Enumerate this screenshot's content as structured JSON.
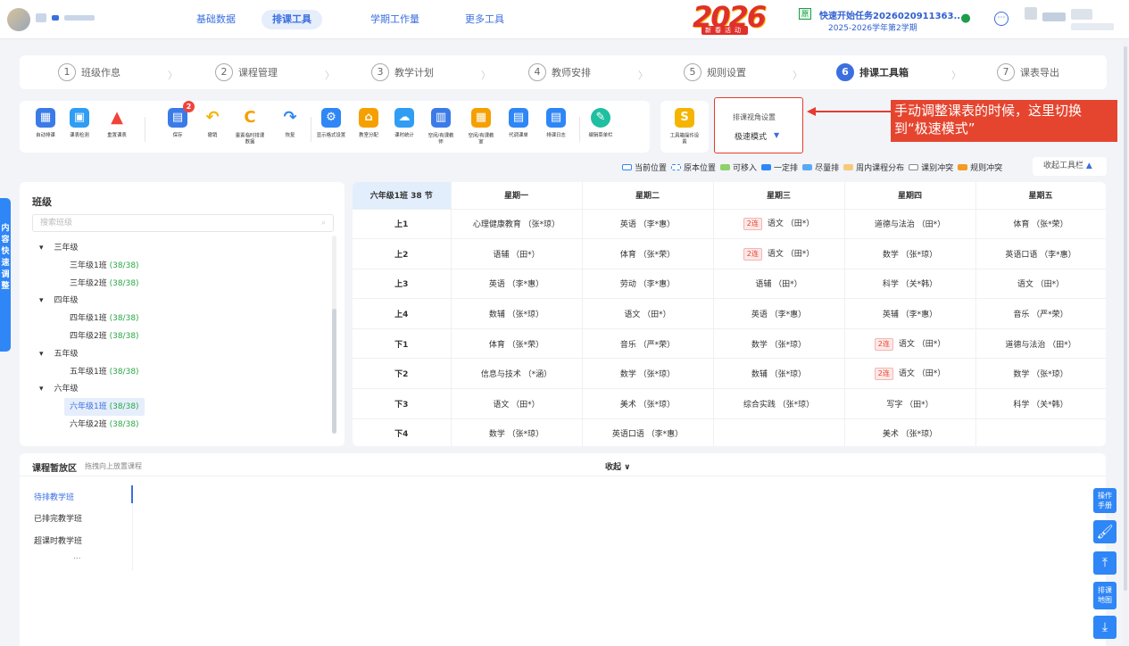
{
  "nav": {
    "links": [
      "基础数据",
      "排课工具",
      "学期工作量",
      "更多工具"
    ],
    "active": 1,
    "event_year": "2026",
    "event_sub": "新春活动",
    "task_tag": "原",
    "task_title": "快速开始任务2026020911363...",
    "term": "2025-2026学年第2学期"
  },
  "steps": [
    {
      "num": "1",
      "label": "班级作息"
    },
    {
      "num": "2",
      "label": "课程管理"
    },
    {
      "num": "3",
      "label": "教学计划"
    },
    {
      "num": "4",
      "label": "教师安排"
    },
    {
      "num": "5",
      "label": "规则设置"
    },
    {
      "num": "6",
      "label": "排课工具箱"
    },
    {
      "num": "7",
      "label": "课表导出"
    }
  ],
  "toolbar": {
    "items": [
      {
        "label": "自动排课",
        "icon": "auto-schedule-icon",
        "color": "#3b7be8"
      },
      {
        "label": "课表检测",
        "icon": "schedule-check-icon",
        "color": "#2f9df4"
      },
      {
        "label": "重置课表",
        "icon": "warning-icon",
        "color": "#f0443a"
      },
      {
        "label": "保存",
        "icon": "save-icon",
        "color": "#3b7be8",
        "badge": "2"
      },
      {
        "label": "撤销",
        "icon": "undo-icon",
        "color": "#f5b400"
      },
      {
        "label": "重置临时排课数据",
        "icon": "reset-data-icon",
        "color": "#f5a000"
      },
      {
        "label": "恢复",
        "icon": "redo-icon",
        "color": "#2f86f6"
      },
      {
        "label": "显示格式设置",
        "icon": "display-settings-icon",
        "color": "#2f86f6"
      },
      {
        "label": "教室分配",
        "icon": "classroom-icon",
        "color": "#f5a000"
      },
      {
        "label": "课时统计",
        "icon": "cloud-stats-icon",
        "color": "#2f9df4"
      },
      {
        "label": "空闲/有课教师",
        "icon": "teacher-free-icon",
        "color": "#3b7be8"
      },
      {
        "label": "空闲/有课教室",
        "icon": "room-free-icon",
        "color": "#f5a000"
      },
      {
        "label": "代调课单",
        "icon": "substitute-icon",
        "color": "#2f86f6"
      },
      {
        "label": "排课日志",
        "icon": "log-icon",
        "color": "#2f86f6"
      },
      {
        "label": "编辑菜单栏",
        "icon": "edit-menu-icon",
        "color": "#1fbfa0"
      }
    ],
    "toolbox_label": "工具箱操作设置",
    "view_title": "排课视角设置",
    "view_mode": "极速模式",
    "callout": "手动调整课表的时候，这里切换到“极速模式”",
    "collapse": "收起工具栏"
  },
  "legend": [
    {
      "label": "当前位置",
      "color": "#ffffff",
      "border": "#2f86f6"
    },
    {
      "label": "原本位置",
      "color": "#ffffff",
      "border": "#2f86f6",
      "dashed": true
    },
    {
      "label": "可移入",
      "color": "#8fd16a"
    },
    {
      "label": "一定排",
      "color": "#2f86f6"
    },
    {
      "label": "尽量排",
      "color": "#5aa9f5"
    },
    {
      "label": "周内课程分布",
      "color": "#f7c97a"
    },
    {
      "label": "课别冲突",
      "color": "#ffffff",
      "border": "#888"
    },
    {
      "label": "规则冲突",
      "color": "#f59a23"
    }
  ],
  "classes": {
    "title": "班级",
    "search_placeholder": "搜索班级",
    "tree": [
      {
        "type": "grade",
        "label": "三年级"
      },
      {
        "type": "class",
        "label": "三年级1班",
        "count": "(38/38)"
      },
      {
        "type": "class",
        "label": "三年级2班",
        "count": "(38/38)"
      },
      {
        "type": "grade",
        "label": "四年级"
      },
      {
        "type": "class",
        "label": "四年级1班",
        "count": "(38/38)"
      },
      {
        "type": "class",
        "label": "四年级2班",
        "count": "(38/38)"
      },
      {
        "type": "grade",
        "label": "五年级"
      },
      {
        "type": "class",
        "label": "五年级1班",
        "count": "(38/38)"
      },
      {
        "type": "grade",
        "label": "六年级"
      },
      {
        "type": "class",
        "label": "六年级1班",
        "count": "(38/38)",
        "selected": true
      },
      {
        "type": "class",
        "label": "六年级2班",
        "count": "(38/38)"
      }
    ]
  },
  "timetable": {
    "corner": "六年级1班 38 节",
    "days": [
      "星期一",
      "星期二",
      "星期三",
      "星期四",
      "星期五"
    ],
    "periods": [
      "上1",
      "上2",
      "上3",
      "上4",
      "下1",
      "下2",
      "下3",
      "下4"
    ],
    "lian_label": "2连",
    "rows": [
      [
        {
          "t": "心理健康教育 （张*琼）"
        },
        {
          "t": "英语 （李*惠）"
        },
        {
          "t": "语文 （田*）",
          "lian": true
        },
        {
          "t": "道德与法治 （田*）"
        },
        {
          "t": "体育 （张*荣）"
        }
      ],
      [
        {
          "t": "语辅 （田*）"
        },
        {
          "t": "体育 （张*荣）"
        },
        {
          "t": "语文 （田*）",
          "lian": true
        },
        {
          "t": "数学 （张*琼）"
        },
        {
          "t": "英语口语 （李*惠）"
        }
      ],
      [
        {
          "t": "英语 （李*惠）"
        },
        {
          "t": "劳动 （李*惠）"
        },
        {
          "t": "语辅 （田*）"
        },
        {
          "t": "科学 （关*韩）"
        },
        {
          "t": "语文 （田*）"
        }
      ],
      [
        {
          "t": "数辅 （张*琼）"
        },
        {
          "t": "语文 （田*）"
        },
        {
          "t": "英语 （李*惠）"
        },
        {
          "t": "英辅 （李*惠）"
        },
        {
          "t": "音乐 （严*荣）"
        }
      ],
      [
        {
          "t": "体育 （张*荣）"
        },
        {
          "t": "音乐 （严*荣）"
        },
        {
          "t": "数学 （张*琼）"
        },
        {
          "t": "语文 （田*）",
          "lian": true
        },
        {
          "t": "道德与法治 （田*）"
        }
      ],
      [
        {
          "t": "信息与技术 （*涵）"
        },
        {
          "t": "数学 （张*琼）"
        },
        {
          "t": "数辅 （张*琼）"
        },
        {
          "t": "语文 （田*）",
          "lian": true
        },
        {
          "t": "数学 （张*琼）"
        }
      ],
      [
        {
          "t": "语文 （田*）"
        },
        {
          "t": "美术 （张*琼）"
        },
        {
          "t": "综合实践 （张*琼）"
        },
        {
          "t": "写字 （田*）"
        },
        {
          "t": "科学 （关*韩）"
        }
      ],
      [
        {
          "t": "数学 （张*琼）"
        },
        {
          "t": "英语口语 （李*惠）"
        },
        {
          "t": ""
        },
        {
          "t": "美术 （张*琼）"
        },
        {
          "t": ""
        }
      ]
    ]
  },
  "pool": {
    "title": "课程暂放区",
    "hint": "拖拽向上放置课程",
    "collapse": "收起 ∨",
    "tabs": [
      "待排教学班",
      "已排完教学班",
      "超课时教学班"
    ],
    "more": "..."
  },
  "side": {
    "quick_adjust": "内容快速调整",
    "manual": "操作手册",
    "map": "排课地图"
  }
}
